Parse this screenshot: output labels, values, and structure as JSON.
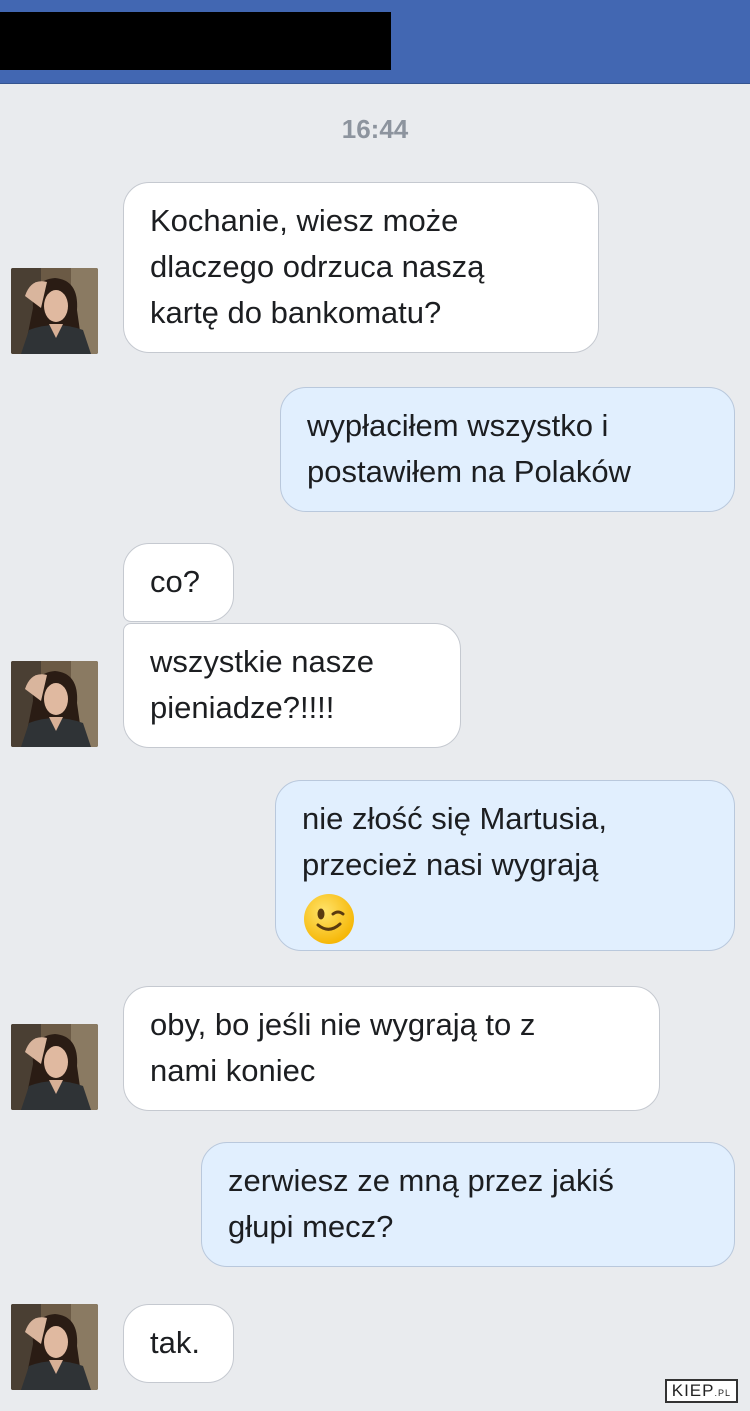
{
  "header": {
    "title_redacted": true
  },
  "timestamp": "16:44",
  "messages": [
    {
      "from": "them",
      "lines": [
        "Kochanie, wiesz może",
        "dlaczego odrzuca naszą",
        "kartę do bankomatu?"
      ]
    },
    {
      "from": "me",
      "lines": [
        "wypłaciłem wszystko i",
        "postawiłem na Polaków"
      ]
    },
    {
      "from": "them",
      "lines": [
        "co?"
      ]
    },
    {
      "from": "them",
      "lines": [
        "wszystkie nasze",
        "pieniadze?!!!!"
      ]
    },
    {
      "from": "me",
      "lines": [
        "nie złość się Martusia,",
        "przecież nasi wygrają"
      ],
      "emoji": "winking-face-emoji"
    },
    {
      "from": "them",
      "lines": [
        "oby, bo jeśli nie wygrają to z",
        "nami koniec"
      ]
    },
    {
      "from": "me",
      "lines": [
        "zerwiesz ze mną przez jakiś",
        "głupi mecz?"
      ]
    },
    {
      "from": "them",
      "lines": [
        "tak."
      ]
    }
  ],
  "watermark": {
    "main": "KIEP",
    "suffix": ".PL"
  },
  "colors": {
    "header": "#4267b2",
    "background": "#e9ebee",
    "outgoing_bubble": "#e1effe",
    "incoming_bubble": "#ffffff"
  }
}
